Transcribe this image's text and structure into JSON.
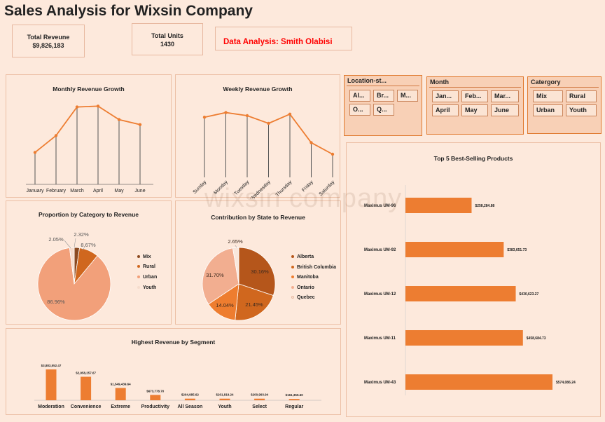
{
  "header": {
    "title": "Sales Analysis for Wixsin Company",
    "revenue_label": "Total Reveune",
    "revenue_value": "$9,826,183",
    "units_label": "Total Units",
    "units_value": "1430",
    "analyst": "Data Analysis: Smith Olabisi",
    "watermark": "wixsin company"
  },
  "colors": {
    "accent": "#ed7d31",
    "analyst": "#ff0000",
    "background": "#fde9dc"
  },
  "slicers": {
    "location": {
      "title": "Location-st...",
      "items": [
        "Al...",
        "Br...",
        "M...",
        "O...",
        "Q..."
      ]
    },
    "month": {
      "title": "Month",
      "items": [
        "Jan...",
        "Feb...",
        "Mar...",
        "April",
        "May",
        "June"
      ]
    },
    "category": {
      "title": "Catergory",
      "items": [
        "Mix",
        "Rural",
        "Urban",
        "Youth"
      ]
    }
  },
  "chart_data": [
    {
      "id": "monthly",
      "type": "line",
      "title": "Monthly Revenue Growth",
      "categories": [
        "January",
        "February",
        "March",
        "April",
        "May",
        "June"
      ],
      "values": [
        0.38,
        0.58,
        0.92,
        0.93,
        0.77,
        0.71
      ]
    },
    {
      "id": "weekly",
      "type": "line",
      "title": "Weekly Revenue Growth",
      "categories": [
        "Sunday",
        "Monday",
        "Tuesday",
        "Wednesday",
        "Thursday",
        "Friday",
        "Saturday"
      ],
      "values": [
        0.78,
        0.84,
        0.8,
        0.7,
        0.82,
        0.45,
        0.3
      ]
    },
    {
      "id": "category",
      "type": "pie",
      "title": "Proportion by Category to Revenue",
      "labels": [
        "Mix",
        "Rural",
        "Urban",
        "Youth"
      ],
      "values": [
        2.32,
        8.67,
        86.96,
        2.05
      ],
      "display": [
        "2.32%",
        "8.67%",
        "86.96%",
        "2.05%"
      ],
      "colors": [
        "#8c4a21",
        "#d0671e",
        "#f2a07a",
        "#f6dccd"
      ]
    },
    {
      "id": "state",
      "type": "pie",
      "title": "Contribution by State to Revenue",
      "labels": [
        "Alberta",
        "British Columbia",
        "Manitoba",
        "Ontario",
        "Quebec"
      ],
      "values": [
        30.16,
        21.45,
        14.04,
        31.7,
        2.65
      ],
      "display": [
        "30.16%",
        "21.45%",
        "14.04%",
        "31.70%",
        "2.65%"
      ],
      "colors": [
        "#b5561b",
        "#d0671e",
        "#ee7d2f",
        "#f2ae90",
        "#f9e7dc"
      ]
    },
    {
      "id": "segment",
      "type": "bar",
      "title": "Highest Revenue by Segment",
      "categories": [
        "Moderation",
        "Convenience",
        "Extreme",
        "Productivity",
        "All Season",
        "Youth",
        "Select",
        "Regular"
      ],
      "values": [
        3883552.47,
        2958257.67,
        1549439.64,
        673778.7,
        204985.62,
        201819.24,
        200993.94,
        161355.6
      ],
      "labels": [
        "$3,883,552.47",
        "$2,958,257.67",
        "$1,549,439.64",
        "$673,778.70",
        "$204,985.62",
        "$201,819.24",
        "$200,993.94",
        "$161,355.60"
      ]
    },
    {
      "id": "products",
      "type": "bar",
      "title": "Top 5 Best-Selling Products",
      "categories": [
        "Maximus UM-96",
        "Maximus UM-92",
        "Maximus UM-12",
        "Maximus UM-11",
        "Maximus UM-43"
      ],
      "values": [
        258284.88,
        383651.73,
        430623.27,
        458684.73,
        574086.24
      ],
      "labels": [
        "$258,284.88",
        "$383,651.73",
        "$430,623.27",
        "$458,684.73",
        "$574,086.24"
      ]
    }
  ]
}
